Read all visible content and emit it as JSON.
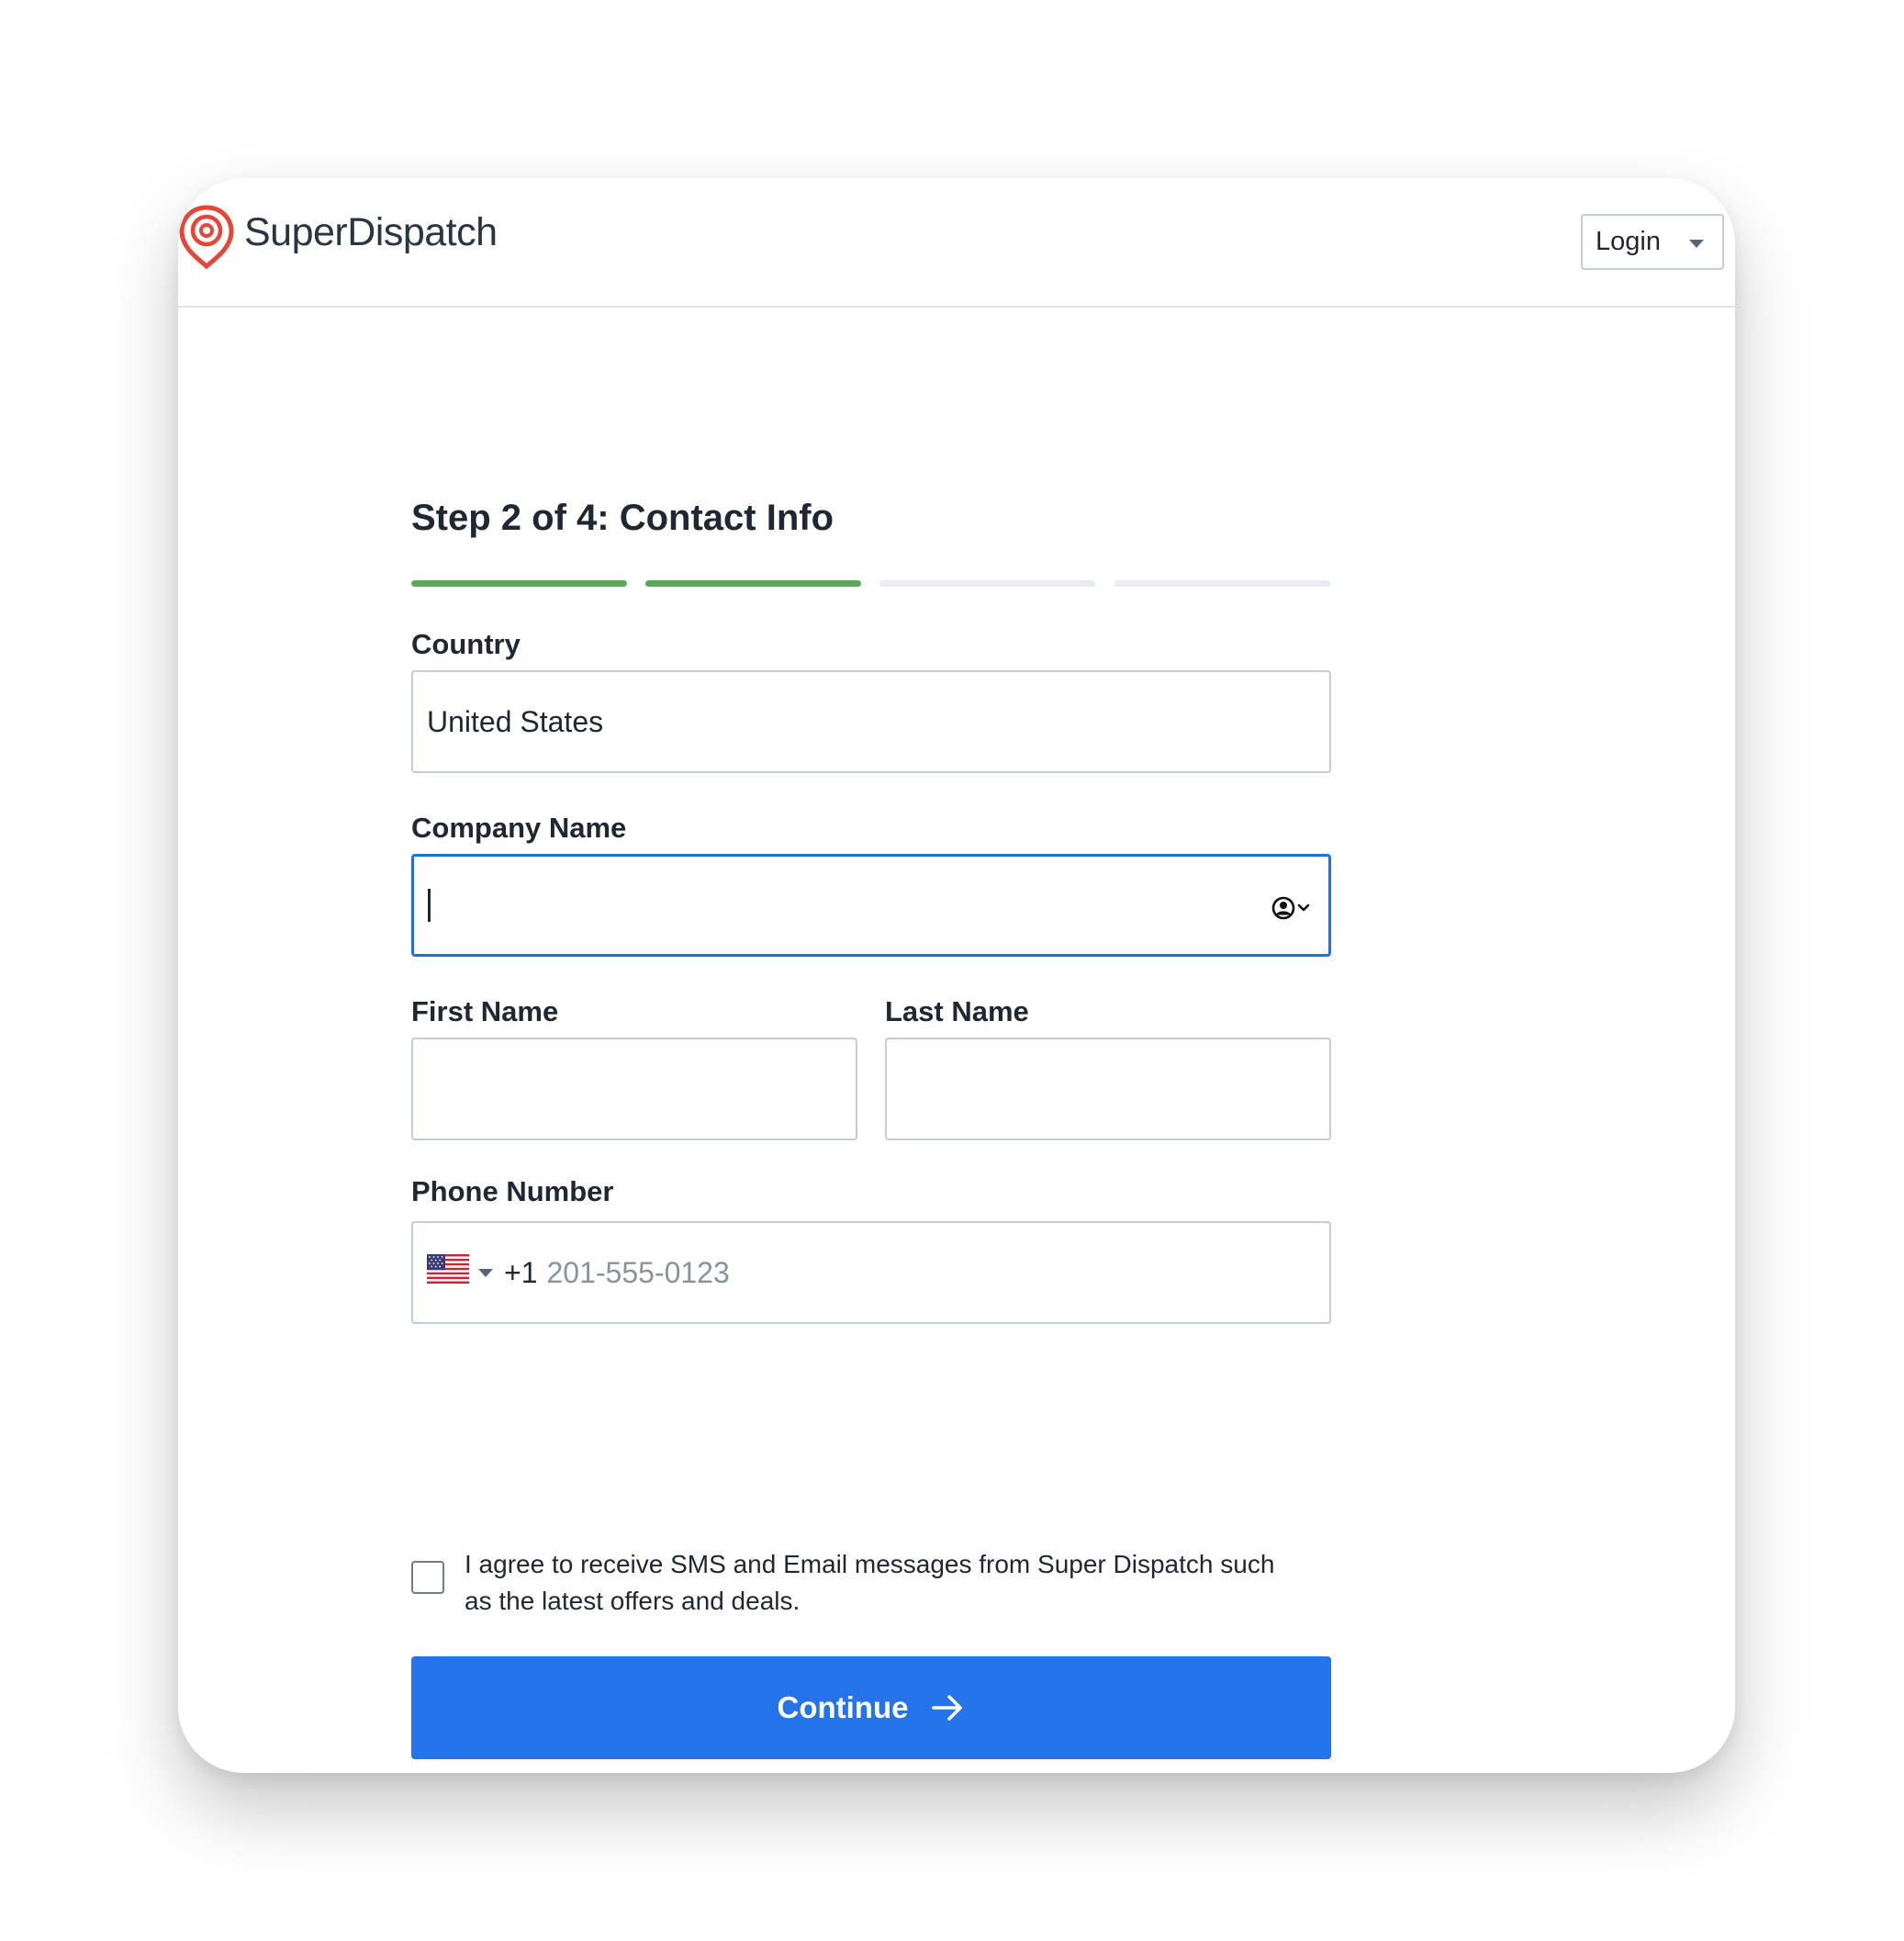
{
  "app": {
    "logo_text": "SuperDispatch",
    "login_label": "Login"
  },
  "form": {
    "step_title": "Step 2 of 4: Contact Info",
    "progress": {
      "total_steps": 4,
      "completed_steps": 2
    },
    "country": {
      "label": "Country",
      "value": "United States"
    },
    "company_name": {
      "label": "Company Name",
      "value": ""
    },
    "first_name": {
      "label": "First Name",
      "value": ""
    },
    "last_name": {
      "label": "Last Name",
      "value": ""
    },
    "phone": {
      "label": "Phone Number",
      "country_code": "+1",
      "placeholder": "201-555-0123"
    },
    "consent": {
      "checked": false,
      "text": "I agree to receive SMS and Email messages from Super Dispatch such as the latest offers and deals."
    },
    "continue_label": "Continue"
  },
  "colors": {
    "primary": "#2473e8",
    "progress_done": "#5ca85a",
    "progress_todo": "#e8ebef",
    "focus_border": "#2170e2",
    "logo_accent": "#e4463a"
  },
  "icons": {
    "logo": "location-pin-icon",
    "login_caret": "caret-down-icon",
    "autofill": "contact-autofill-icon",
    "flag": "us-flag-icon",
    "continue_arrow": "arrow-right-icon"
  }
}
